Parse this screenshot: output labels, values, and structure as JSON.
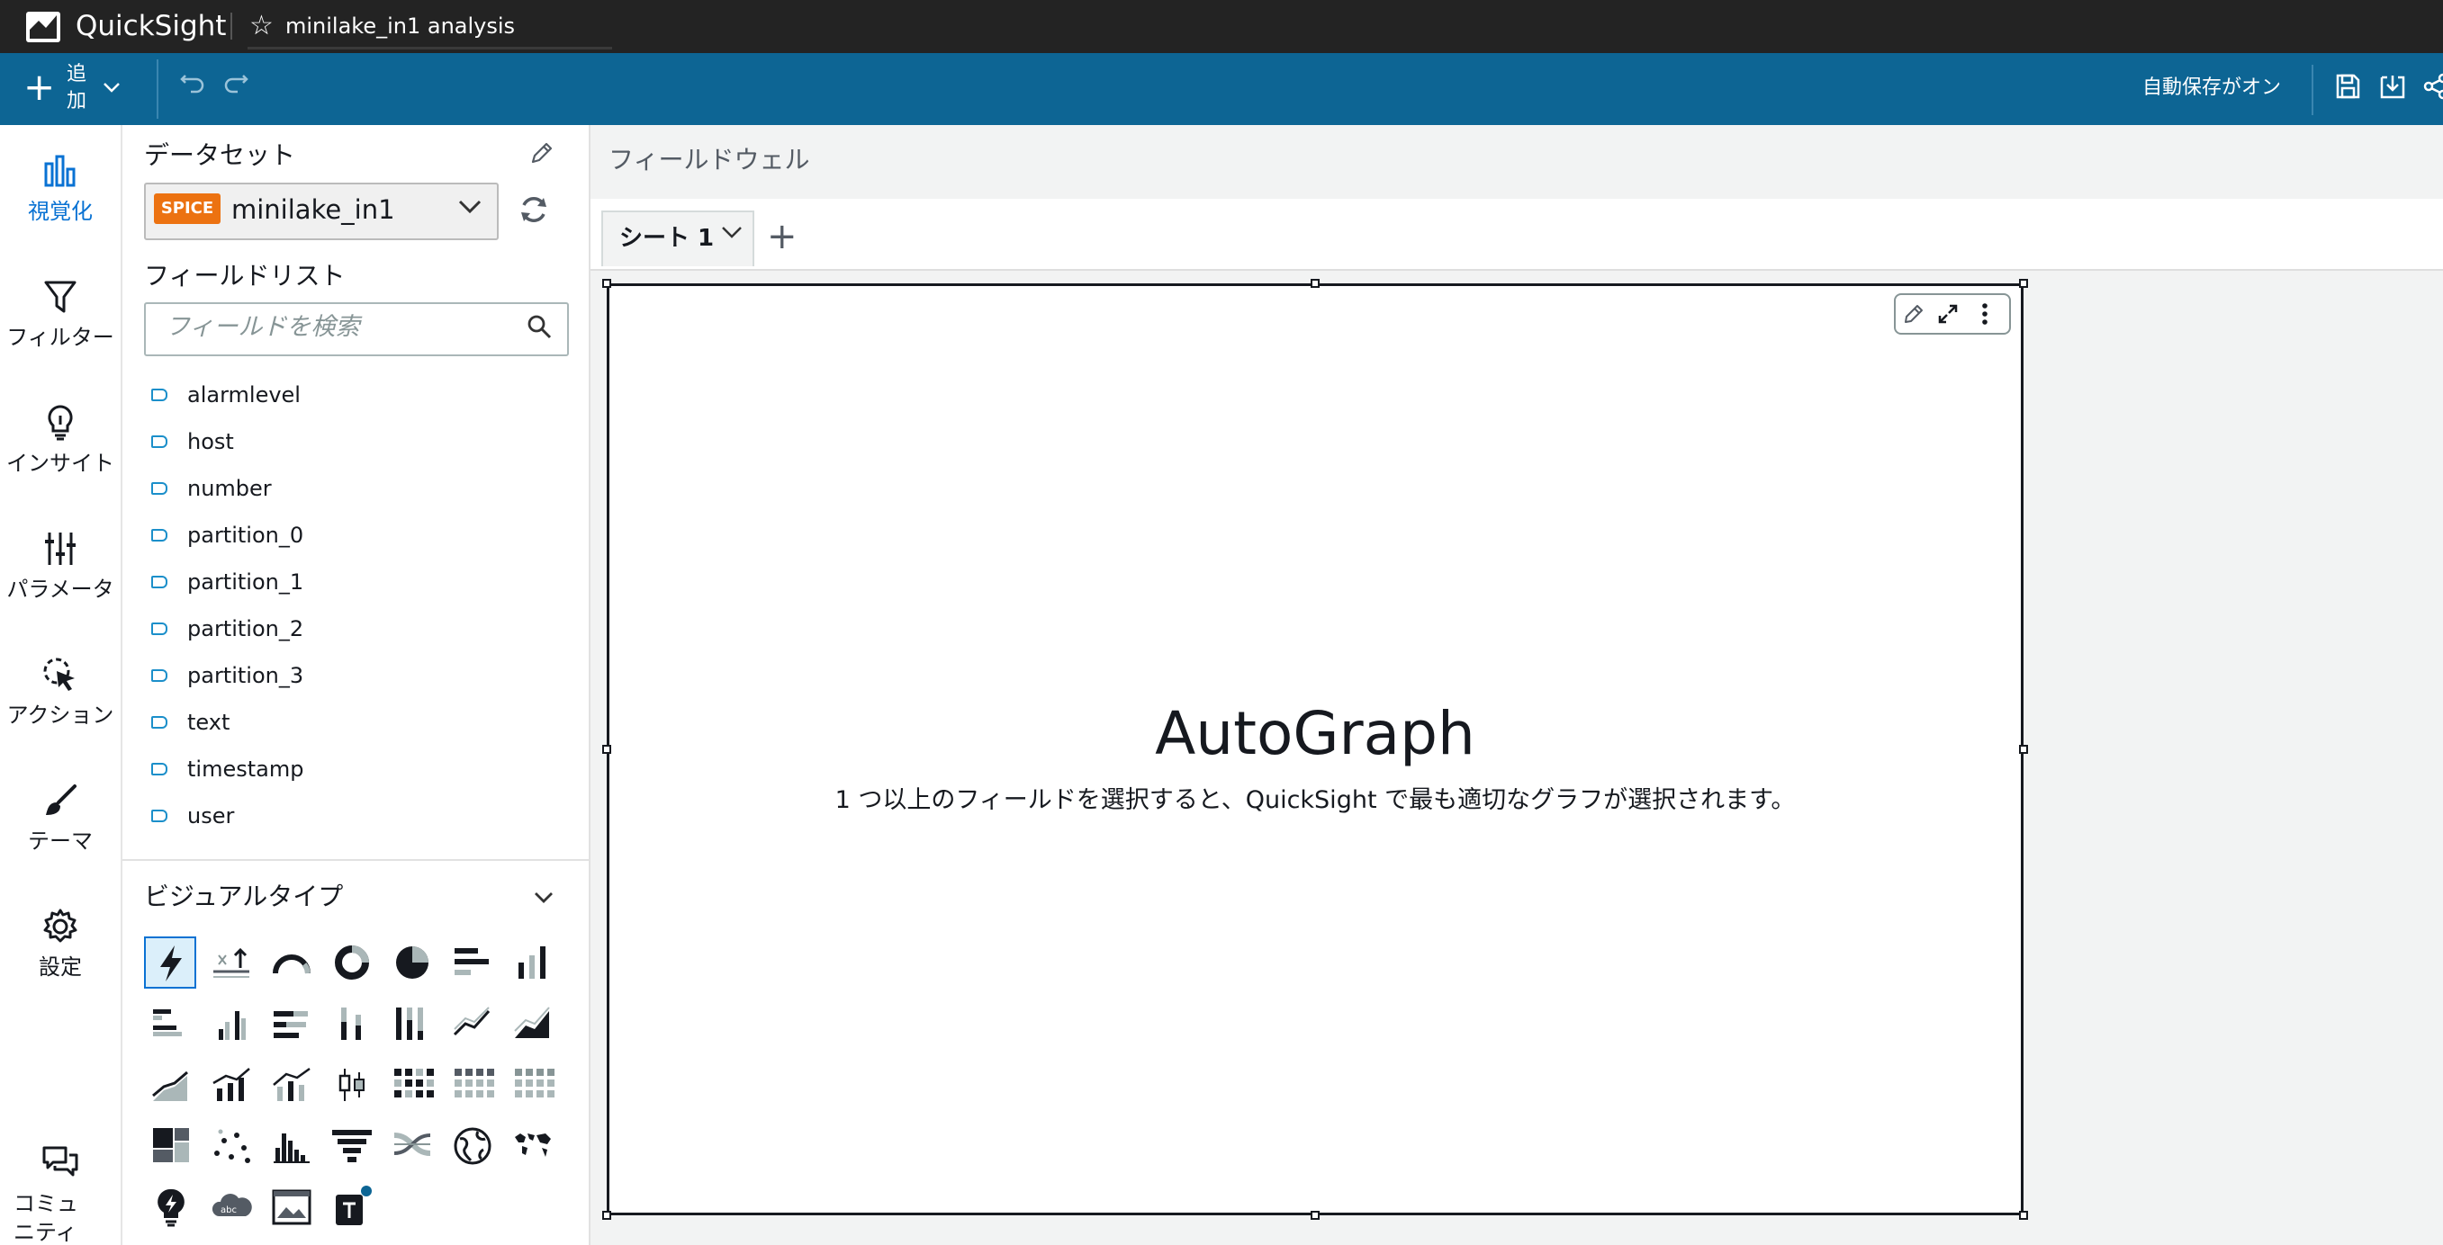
{
  "app": {
    "name": "QuickSight",
    "analysis_title": "minilake_in1 analysis"
  },
  "toolbar": {
    "add_label": "追加",
    "autosave_label": "自動保存がオン"
  },
  "rail": {
    "items": [
      {
        "key": "visualize",
        "label": "視覚化",
        "active": true
      },
      {
        "key": "filter",
        "label": "フィルター"
      },
      {
        "key": "insights",
        "label": "インサイト"
      },
      {
        "key": "parameters",
        "label": "パラメータ"
      },
      {
        "key": "actions",
        "label": "アクション"
      },
      {
        "key": "themes",
        "label": "テーマ"
      },
      {
        "key": "settings",
        "label": "設定"
      },
      {
        "key": "community",
        "label": "コミュニティ"
      }
    ]
  },
  "panel": {
    "dataset_heading": "データセット",
    "dataset_badge": "SPICE",
    "dataset_name": "minilake_in1",
    "field_list_heading": "フィールドリスト",
    "search_placeholder": "フィールドを検索",
    "fields": [
      "alarmlevel",
      "host",
      "number",
      "partition_0",
      "partition_1",
      "partition_2",
      "partition_3",
      "text",
      "timestamp",
      "user"
    ],
    "visual_types_heading": "ビジュアルタイプ"
  },
  "main": {
    "field_well_label": "フィールドウェル",
    "sheet_tab_label": "シート 1",
    "autograph_title": "AutoGraph",
    "autograph_subtitle": "1 つ以上のフィールドを選択すると、QuickSight で最も適切なグラフが選択されます。"
  },
  "colors": {
    "toolbar": "#0d6594",
    "topbar": "#232323",
    "accent": "#0972d3",
    "spice": "#ec7211"
  }
}
